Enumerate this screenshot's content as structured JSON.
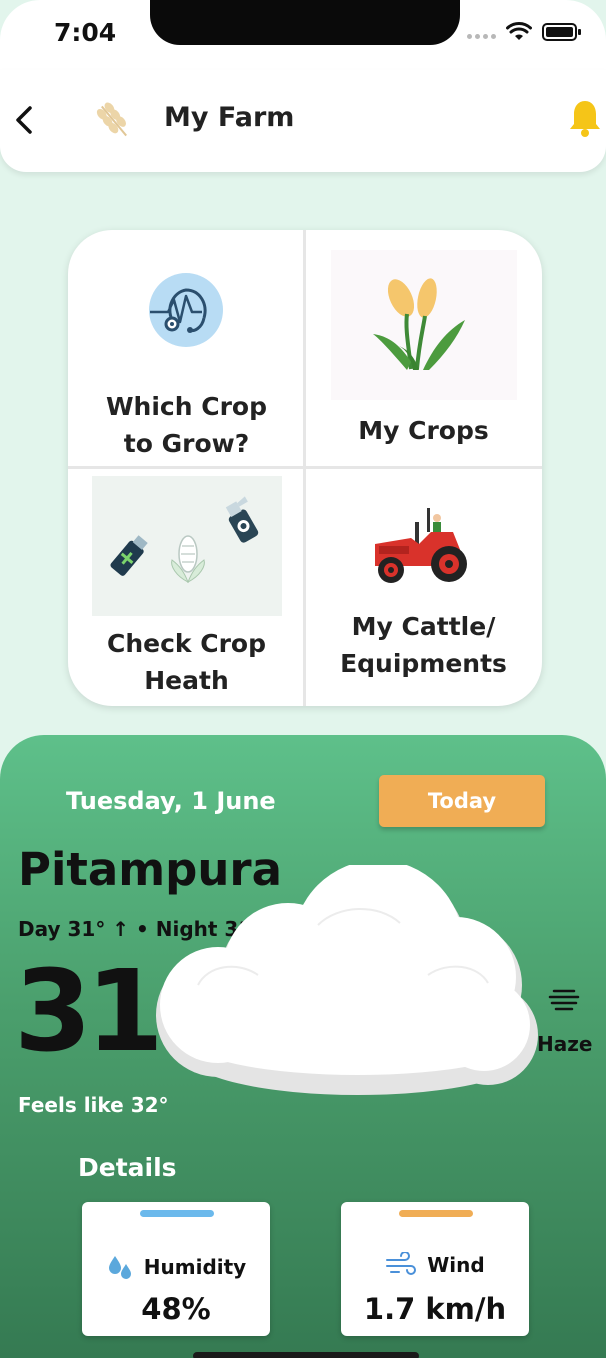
{
  "status_bar": {
    "time": "7:04"
  },
  "header": {
    "title": "My Farm"
  },
  "grid": {
    "which_crop": "Which Crop\nto Grow?",
    "my_crops": "My Crops",
    "check_health": "Check Crop\nHeath",
    "cattle": "My Cattle/\nEquipments"
  },
  "weather": {
    "date": "Tuesday, 1 June",
    "today_button": "Today",
    "city": "Pitampura",
    "day_night": "Day 31° ↑ • Night 31° ↓",
    "temperature": "31°",
    "condition": "Haze",
    "feels_like": "Feels like 32°",
    "details_title": "Details",
    "humidity": {
      "label": "Humidity",
      "value": "48%"
    },
    "wind": {
      "label": "Wind",
      "value": "1.7 km/h"
    }
  },
  "colors": {
    "accent_orange": "#f0ad55",
    "humidity_bar": "#6bb9ec",
    "wind_bar": "#f0ad55",
    "bell": "#f5c518"
  }
}
